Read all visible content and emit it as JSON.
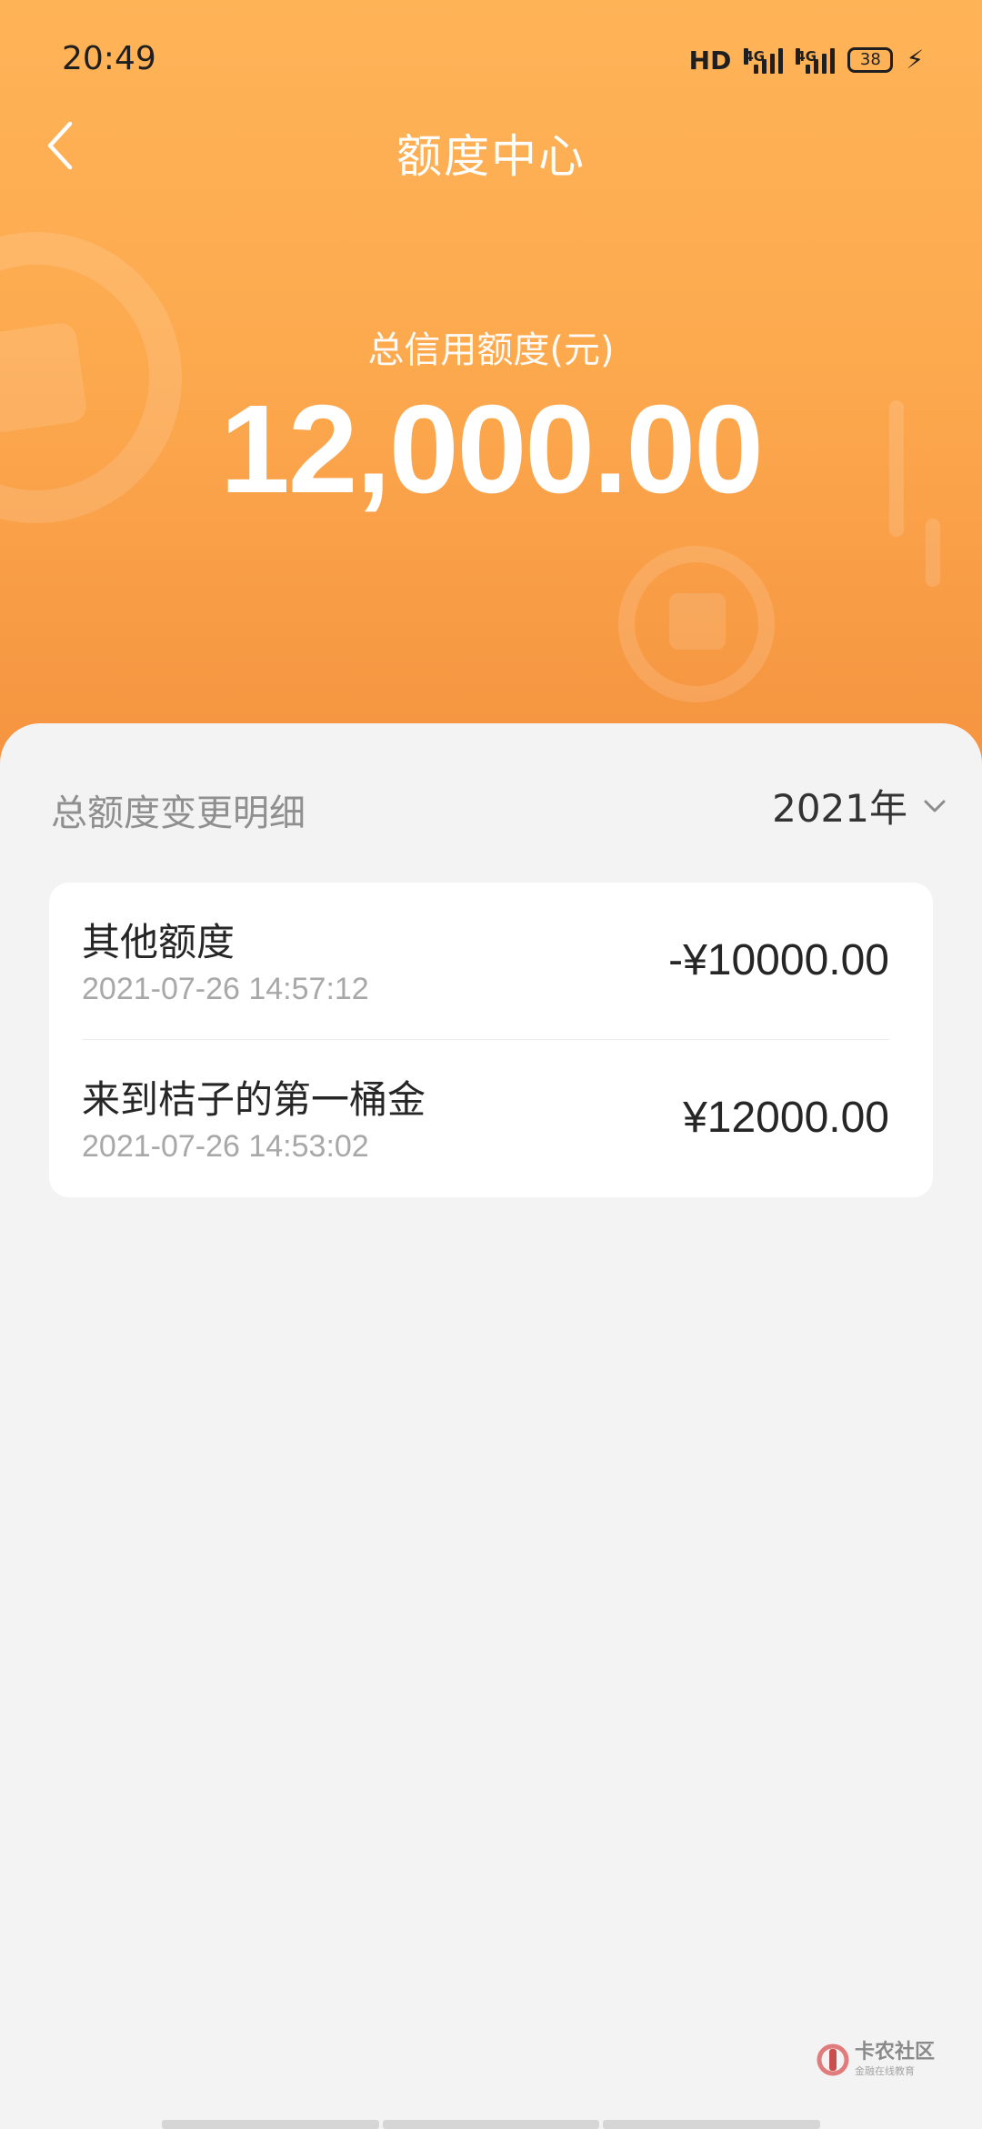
{
  "status_bar": {
    "time": "20:49",
    "hd_label": "HD",
    "network_1": "4G",
    "network_2": "4G",
    "battery_level": "38"
  },
  "nav": {
    "title": "额度中心",
    "back_icon": "chevron-left-icon"
  },
  "credit": {
    "label": "总信用额度(元)",
    "amount": "12,000.00"
  },
  "details": {
    "section_title": "总额度变更明细",
    "year_filter": "2021年",
    "records": [
      {
        "title": "其他额度",
        "time": "2021-07-26 14:57:12",
        "amount": "-¥10000.00"
      },
      {
        "title": "来到桔子的第一桶金",
        "time": "2021-07-26 14:53:02",
        "amount": "¥12000.00"
      }
    ]
  },
  "watermark": {
    "name": "卡农社区",
    "subtitle": "金融在线教育"
  },
  "colors": {
    "hero_top": "#ffb357",
    "hero_bottom": "#f59440",
    "background": "#f3f3f3"
  }
}
